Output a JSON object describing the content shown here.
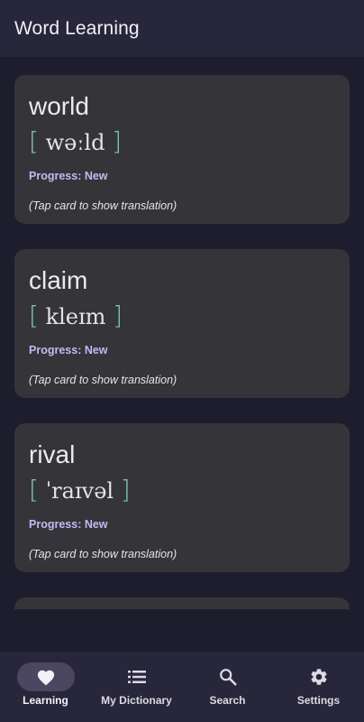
{
  "app_bar": {
    "title": "Word Learning"
  },
  "cards": [
    {
      "word": "world",
      "pronunciation": "wəːld",
      "progress": "Progress: New",
      "hint": "(Tap card to show translation)"
    },
    {
      "word": "claim",
      "pronunciation": "kleɪm",
      "progress": "Progress: New",
      "hint": "(Tap card to show translation)"
    },
    {
      "word": "rival",
      "pronunciation": "ˈraɪvəl",
      "progress": "Progress: New",
      "hint": "(Tap card to show translation)"
    }
  ],
  "brackets": {
    "open": "[",
    "close": "]"
  },
  "bottom_nav": {
    "items": [
      {
        "label": "Learning",
        "icon": "heart-icon",
        "active": true
      },
      {
        "label": "My Dictionary",
        "icon": "list-icon",
        "active": false
      },
      {
        "label": "Search",
        "icon": "search-icon",
        "active": false
      },
      {
        "label": "Settings",
        "icon": "gear-icon",
        "active": false
      }
    ]
  },
  "colors": {
    "background": "#1e1d2e",
    "surface": "#27263a",
    "card": "#353438",
    "accent_bracket": "#7cc4bb",
    "progress_text": "#c7b6f2",
    "active_pill": "#4b4760"
  }
}
